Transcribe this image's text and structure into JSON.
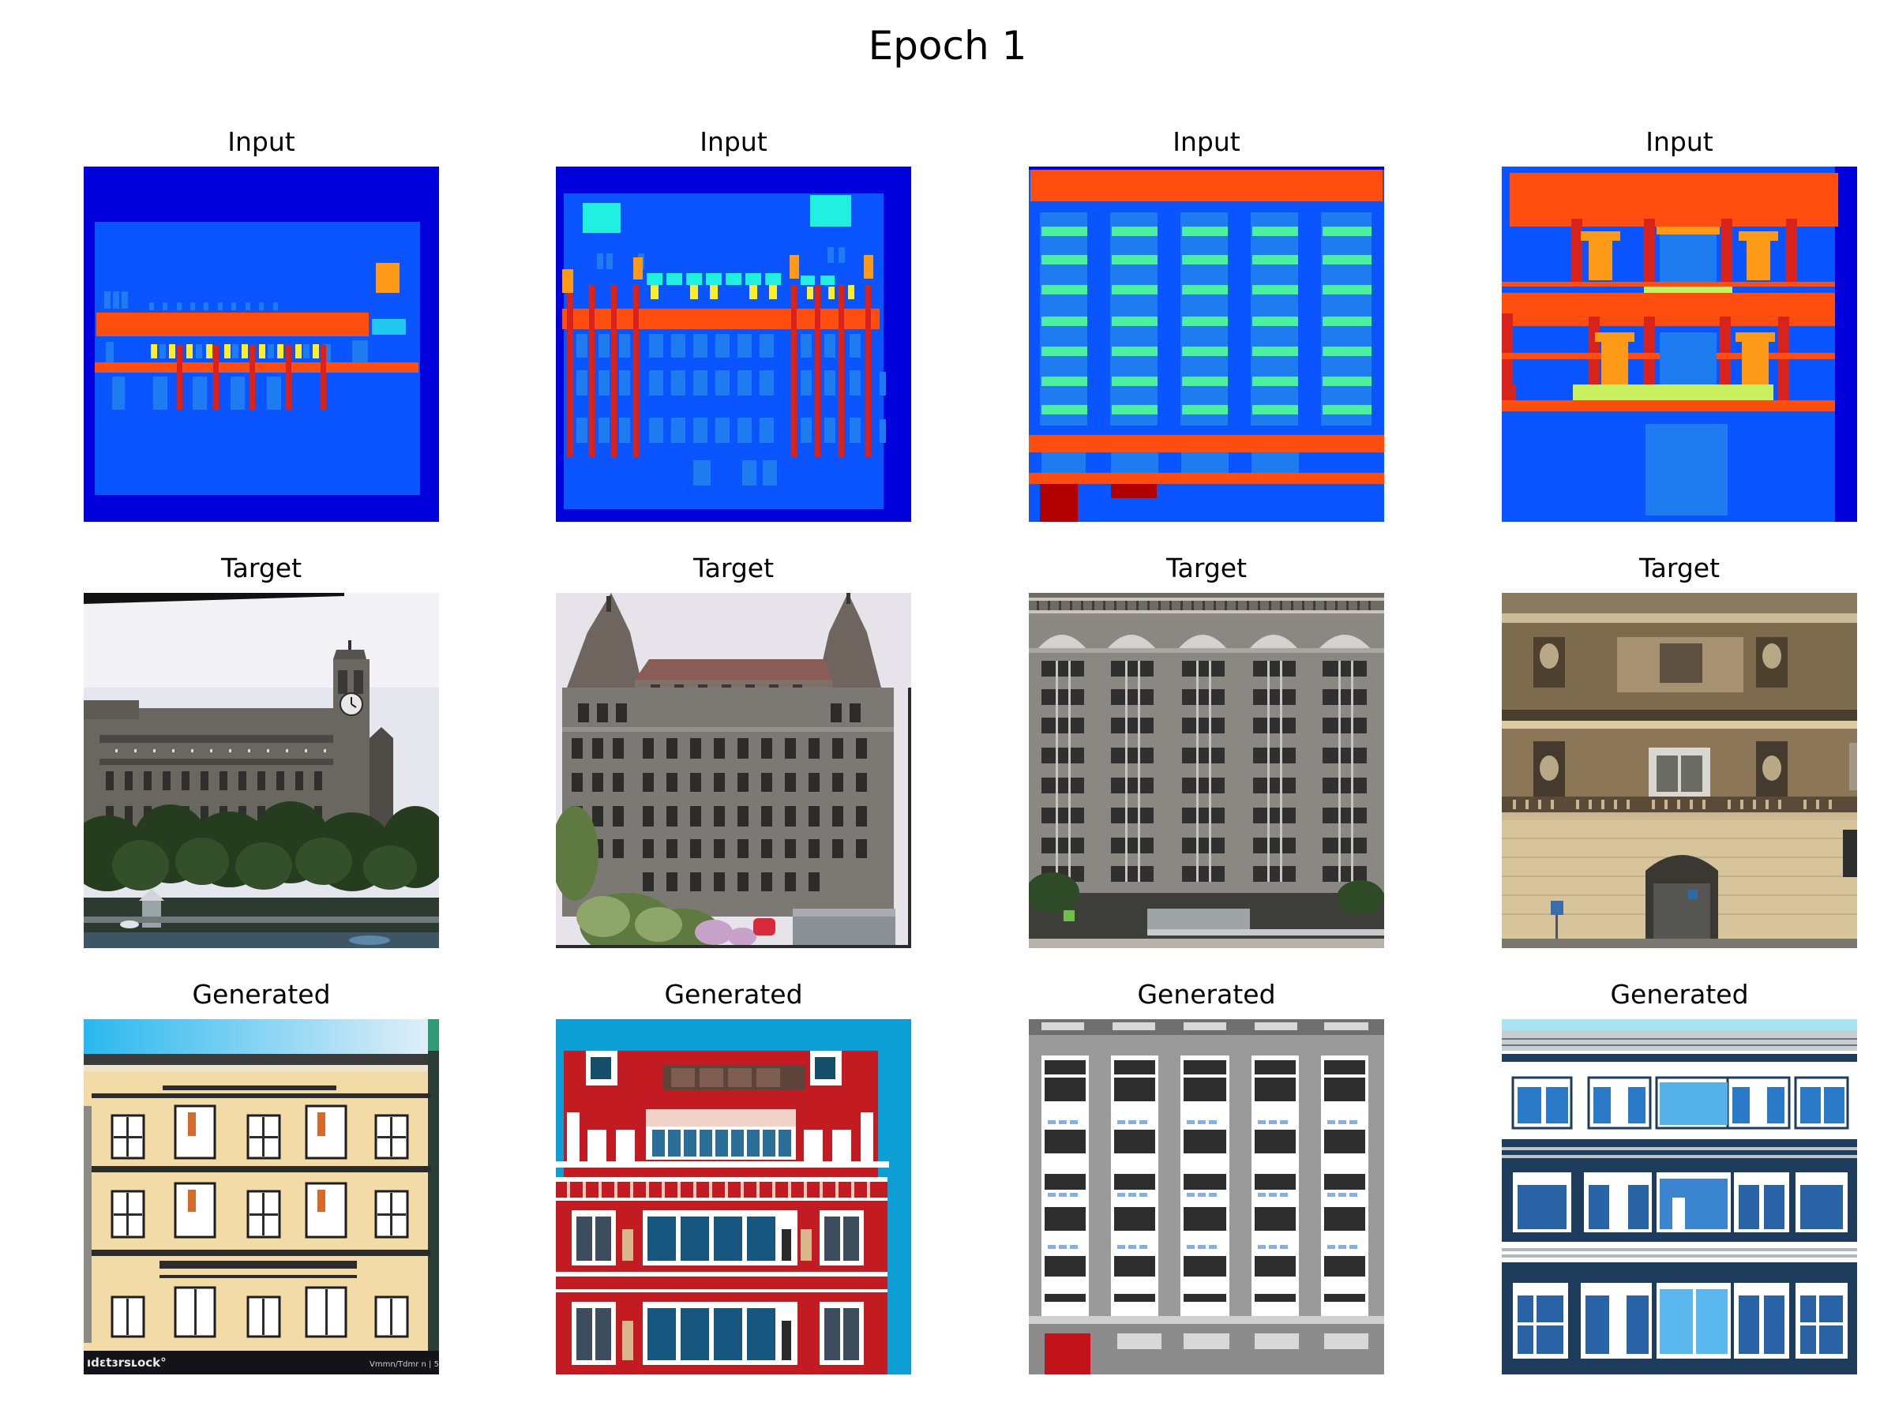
{
  "figure": {
    "title": "Epoch 1",
    "rows": [
      {
        "label": "Input"
      },
      {
        "label": "Target"
      },
      {
        "label": "Generated"
      }
    ],
    "watermark": {
      "left": "ıdɛtɜrsʟock°",
      "right": "Vmmn/Tdmr n | 5ft"
    }
  }
}
